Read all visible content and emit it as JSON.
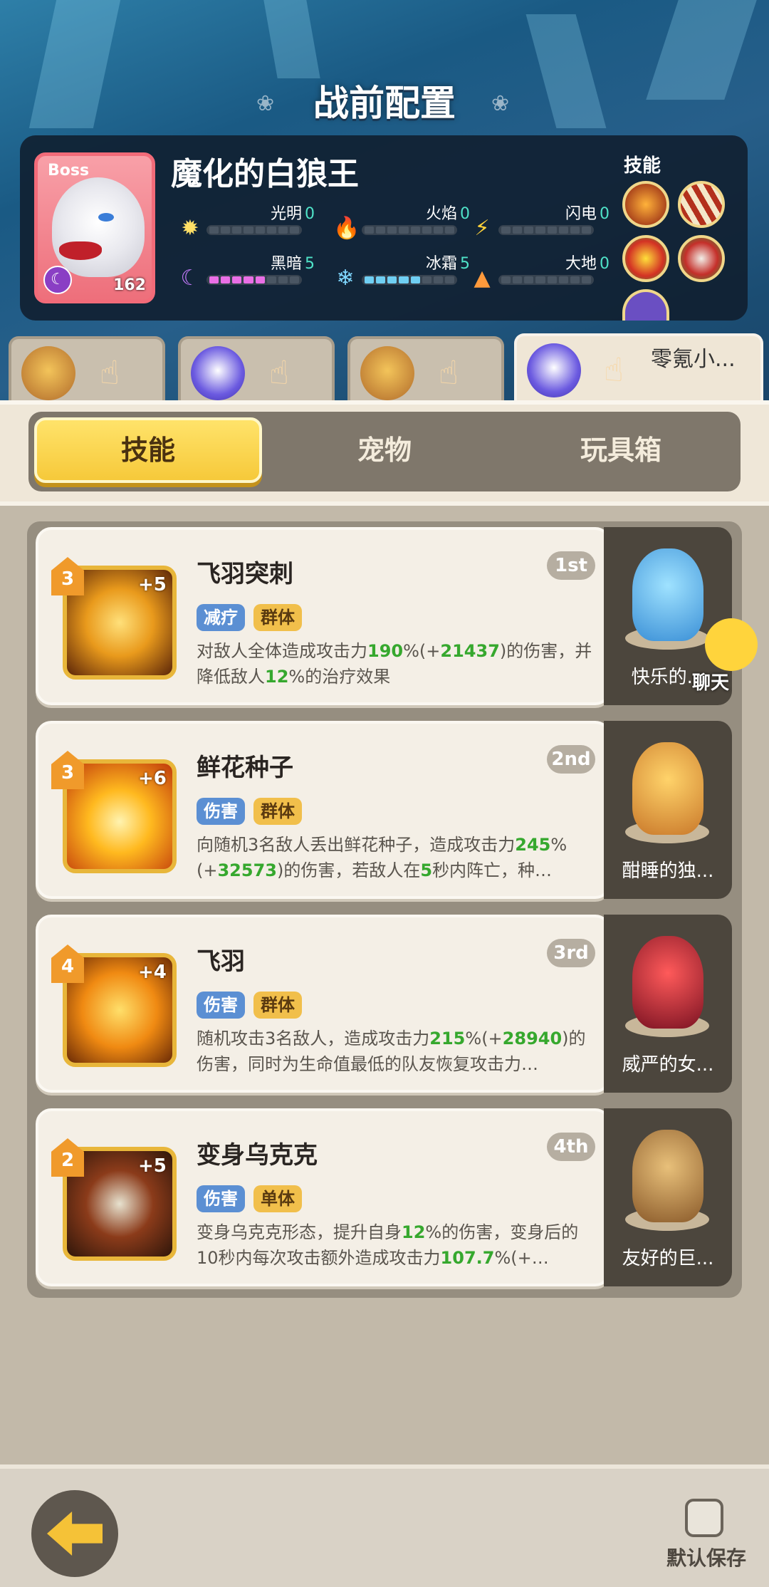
{
  "header": {
    "title": "战前配置"
  },
  "boss": {
    "badge": "Boss",
    "level": "162",
    "name": "魔化的白狼王",
    "stats": [
      {
        "label": "光明",
        "value": "0",
        "icon": "sun-icon",
        "level": 0
      },
      {
        "label": "火焰",
        "value": "0",
        "icon": "fire-icon",
        "level": 0
      },
      {
        "label": "闪电",
        "value": "0",
        "icon": "lightning-icon",
        "level": 0
      },
      {
        "label": "黑暗",
        "value": "5",
        "icon": "moon-icon",
        "level": 5
      },
      {
        "label": "冰霜",
        "value": "5",
        "icon": "snowflake-icon",
        "level": 5
      },
      {
        "label": "大地",
        "value": "0",
        "icon": "earth-icon",
        "level": 0
      }
    ],
    "skills_label": "技能"
  },
  "team_slots": [
    {
      "pet_icon": "bear-pet-icon"
    },
    {
      "pet_icon": "penguin-pet-icon"
    },
    {
      "pet_icon": "bear-pet-icon"
    },
    {
      "pet_icon": "penguin-pet-icon",
      "name": "零氪小..."
    }
  ],
  "tabs": [
    {
      "label": "技能",
      "active": true
    },
    {
      "label": "宠物",
      "active": false
    },
    {
      "label": "玩具箱",
      "active": false
    }
  ],
  "skills": [
    {
      "title": "飞羽突刺",
      "rank": "1st",
      "level": "3",
      "plus": "+5",
      "tags": [
        "减疗",
        "群体"
      ],
      "desc_parts": [
        [
          "对敌人全体造成攻击力",
          ""
        ],
        [
          "190",
          "g"
        ],
        [
          "%(+",
          ""
        ],
        [
          "21437",
          "g"
        ],
        [
          ")的伤害，并降低敌人",
          ""
        ],
        [
          "12",
          "g"
        ],
        [
          "%的治疗效果",
          ""
        ]
      ],
      "pet_name": "快乐的..."
    },
    {
      "title": "鲜花种子",
      "rank": "2nd",
      "level": "3",
      "plus": "+6",
      "tags": [
        "伤害",
        "群体"
      ],
      "desc_parts": [
        [
          "向随机3名敌人丢出鲜花种子，造成攻击力",
          ""
        ],
        [
          "245",
          "g"
        ],
        [
          "%(+",
          ""
        ],
        [
          "32573",
          "g"
        ],
        [
          ")的伤害，若敌人在",
          ""
        ],
        [
          "5",
          "g"
        ],
        [
          "秒内阵亡，种…",
          ""
        ]
      ],
      "pet_name": "酣睡的独..."
    },
    {
      "title": "飞羽",
      "rank": "3rd",
      "level": "4",
      "plus": "+4",
      "tags": [
        "伤害",
        "群体"
      ],
      "desc_parts": [
        [
          "随机攻击3名敌人，造成攻击力",
          ""
        ],
        [
          "215",
          "g"
        ],
        [
          "%(+",
          ""
        ],
        [
          "28940",
          "g"
        ],
        [
          ")的伤害，同时为生命值最低的队友恢复攻击力…",
          ""
        ]
      ],
      "pet_name": "威严的女..."
    },
    {
      "title": "变身乌克克",
      "rank": "4th",
      "level": "2",
      "plus": "+5",
      "tags": [
        "伤害",
        "单体"
      ],
      "desc_parts": [
        [
          "变身乌克克形态，提升自身",
          ""
        ],
        [
          "12",
          "g"
        ],
        [
          "%的伤害，变身后的10秒内每次攻击额外造成攻击力",
          ""
        ],
        [
          "107.7",
          "g"
        ],
        [
          "%(+…",
          ""
        ]
      ],
      "pet_name": "友好的巨..."
    }
  ],
  "chat": {
    "label": "聊天"
  },
  "bottom": {
    "save_label": "默认保存"
  }
}
